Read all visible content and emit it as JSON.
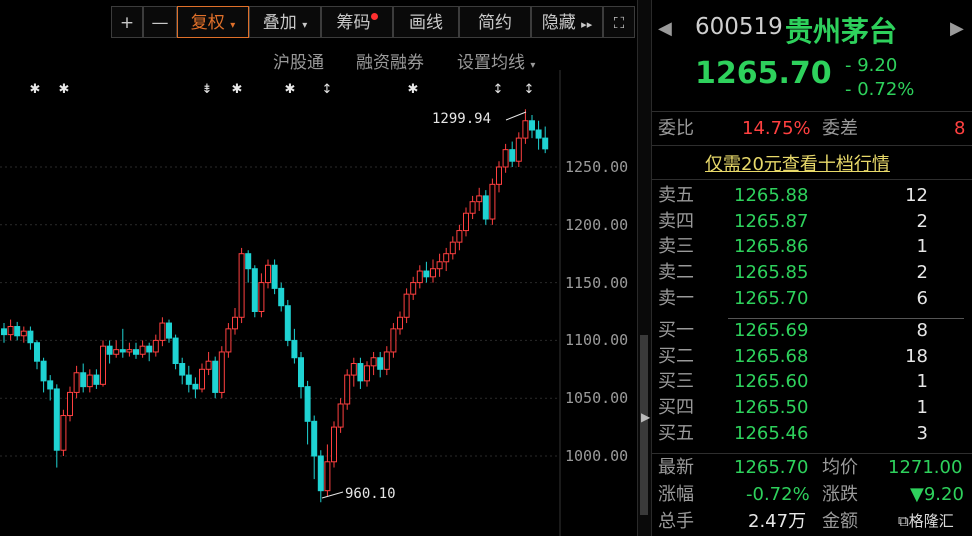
{
  "toolbar": {
    "plus": "+",
    "minus": "—",
    "fuquan": "复权",
    "diejia": "叠加",
    "chouma": "筹码",
    "huaxian": "画线",
    "jianyue": "简约",
    "yincang": "隐藏",
    "more": "▸▸",
    "expand": "⛶"
  },
  "subbar": {
    "hgt": "沪股通",
    "rzrq": "融资融券",
    "junxian": "设置均线"
  },
  "stock": {
    "code": "600519",
    "name": "贵州茅台",
    "price": "1265.70",
    "change": "- 9.20",
    "change_pct": "- 0.72%"
  },
  "weibi": {
    "label_wb": "委比",
    "wb_value": "14.75%",
    "label_wc": "委差",
    "wc_value": "8",
    "promo": "仅需20元查看十档行情"
  },
  "asks": [
    {
      "label": "卖五",
      "price": "1265.88",
      "vol": "12"
    },
    {
      "label": "卖四",
      "price": "1265.87",
      "vol": "2"
    },
    {
      "label": "卖三",
      "price": "1265.86",
      "vol": "1"
    },
    {
      "label": "卖二",
      "price": "1265.85",
      "vol": "2"
    },
    {
      "label": "卖一",
      "price": "1265.70",
      "vol": "6"
    }
  ],
  "bids": [
    {
      "label": "买一",
      "price": "1265.69",
      "vol": "8"
    },
    {
      "label": "买二",
      "price": "1265.68",
      "vol": "18"
    },
    {
      "label": "买三",
      "price": "1265.60",
      "vol": "1"
    },
    {
      "label": "买四",
      "price": "1265.50",
      "vol": "1"
    },
    {
      "label": "买五",
      "price": "1265.46",
      "vol": "3"
    }
  ],
  "stats": {
    "latest_label": "最新",
    "latest": "1265.70",
    "avg_label": "均价",
    "avg": "1271.00",
    "pct_label": "涨幅",
    "pct": "-0.72%",
    "chg_label": "涨跌",
    "chg": "▼9.20",
    "vol_label": "总手",
    "vol": "2.47万",
    "amt_label": "金额"
  },
  "watermark": "格隆汇",
  "colors": {
    "up": "#ff4040",
    "down": "#1fd3d3",
    "accent": "#e0702a",
    "green": "#2ed15c"
  },
  "chart_data": {
    "type": "candlestick",
    "y_ticks": [
      "1250.00",
      "1200.00",
      "1150.00",
      "1100.00",
      "1050.00",
      "1000.00"
    ],
    "high_label": "1299.94",
    "low_label": "960.10",
    "candles": [
      [
        1110,
        1105,
        1115,
        1098
      ],
      [
        1105,
        1112,
        1118,
        1100
      ],
      [
        1112,
        1104,
        1116,
        1100
      ],
      [
        1104,
        1108,
        1112,
        1098
      ],
      [
        1108,
        1098,
        1112,
        1092
      ],
      [
        1098,
        1082,
        1100,
        1075
      ],
      [
        1082,
        1065,
        1085,
        1055
      ],
      [
        1065,
        1058,
        1070,
        1048
      ],
      [
        1058,
        1005,
        1062,
        990
      ],
      [
        1005,
        1035,
        1040,
        1000
      ],
      [
        1035,
        1055,
        1060,
        1030
      ],
      [
        1055,
        1072,
        1078,
        1050
      ],
      [
        1072,
        1060,
        1080,
        1055
      ],
      [
        1060,
        1070,
        1075,
        1055
      ],
      [
        1070,
        1062,
        1075,
        1058
      ],
      [
        1062,
        1095,
        1100,
        1060
      ],
      [
        1095,
        1088,
        1100,
        1080
      ],
      [
        1088,
        1092,
        1100,
        1085
      ],
      [
        1092,
        1090,
        1110,
        1085
      ],
      [
        1090,
        1092,
        1098,
        1086
      ],
      [
        1092,
        1088,
        1098,
        1084
      ],
      [
        1088,
        1095,
        1100,
        1085
      ],
      [
        1095,
        1090,
        1098,
        1082
      ],
      [
        1090,
        1100,
        1105,
        1086
      ],
      [
        1100,
        1115,
        1120,
        1095
      ],
      [
        1115,
        1102,
        1118,
        1098
      ],
      [
        1102,
        1080,
        1105,
        1075
      ],
      [
        1080,
        1070,
        1085,
        1062
      ],
      [
        1070,
        1062,
        1078,
        1055
      ],
      [
        1062,
        1058,
        1068,
        1050
      ],
      [
        1058,
        1075,
        1080,
        1055
      ],
      [
        1075,
        1082,
        1090,
        1070
      ],
      [
        1082,
        1055,
        1086,
        1050
      ],
      [
        1055,
        1090,
        1095,
        1050
      ],
      [
        1090,
        1110,
        1115,
        1085
      ],
      [
        1110,
        1120,
        1128,
        1105
      ],
      [
        1120,
        1175,
        1180,
        1115
      ],
      [
        1175,
        1162,
        1178,
        1150
      ],
      [
        1162,
        1125,
        1165,
        1120
      ],
      [
        1125,
        1150,
        1158,
        1120
      ],
      [
        1150,
        1165,
        1170,
        1145
      ],
      [
        1165,
        1145,
        1170,
        1140
      ],
      [
        1145,
        1130,
        1150,
        1125
      ],
      [
        1130,
        1100,
        1135,
        1095
      ],
      [
        1100,
        1085,
        1110,
        1080
      ],
      [
        1085,
        1060,
        1090,
        1050
      ],
      [
        1060,
        1030,
        1065,
        1010
      ],
      [
        1030,
        1000,
        1035,
        980
      ],
      [
        1000,
        970,
        1005,
        960
      ],
      [
        970,
        995,
        1010,
        965
      ],
      [
        995,
        1025,
        1030,
        990
      ],
      [
        1025,
        1045,
        1050,
        1020
      ],
      [
        1045,
        1070,
        1075,
        1040
      ],
      [
        1070,
        1080,
        1085,
        1060
      ],
      [
        1080,
        1065,
        1085,
        1058
      ],
      [
        1065,
        1078,
        1082,
        1060
      ],
      [
        1078,
        1085,
        1090,
        1070
      ],
      [
        1085,
        1075,
        1090,
        1068
      ],
      [
        1075,
        1090,
        1095,
        1070
      ],
      [
        1090,
        1110,
        1115,
        1085
      ],
      [
        1110,
        1120,
        1125,
        1105
      ],
      [
        1120,
        1140,
        1145,
        1115
      ],
      [
        1140,
        1150,
        1155,
        1135
      ],
      [
        1150,
        1160,
        1165,
        1145
      ],
      [
        1160,
        1155,
        1168,
        1150
      ],
      [
        1155,
        1162,
        1170,
        1150
      ],
      [
        1162,
        1168,
        1175,
        1155
      ],
      [
        1168,
        1175,
        1180,
        1160
      ],
      [
        1175,
        1185,
        1190,
        1170
      ],
      [
        1185,
        1195,
        1200,
        1178
      ],
      [
        1195,
        1210,
        1215,
        1190
      ],
      [
        1210,
        1220,
        1225,
        1205
      ],
      [
        1220,
        1225,
        1232,
        1212
      ],
      [
        1225,
        1205,
        1230,
        1200
      ],
      [
        1205,
        1235,
        1240,
        1200
      ],
      [
        1235,
        1250,
        1255,
        1228
      ],
      [
        1250,
        1265,
        1270,
        1245
      ],
      [
        1265,
        1255,
        1272,
        1250
      ],
      [
        1255,
        1275,
        1280,
        1250
      ],
      [
        1275,
        1290,
        1299.94,
        1270
      ],
      [
        1290,
        1282,
        1295,
        1275
      ],
      [
        1282,
        1275,
        1290,
        1265
      ],
      [
        1275,
        1265.7,
        1285,
        1262
      ]
    ]
  }
}
